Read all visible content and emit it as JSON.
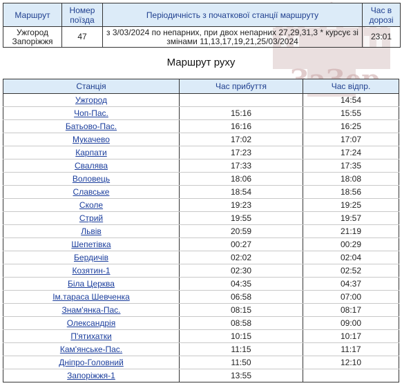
{
  "info": {
    "headers": {
      "route": "Маршрут",
      "train_no": "Номер поїзда",
      "periodicity": "Періодичність з початкової станції маршруту",
      "travel_time": "Час в дорозі"
    },
    "row": {
      "route_from": "Ужгород",
      "route_to": "Запоріжжя",
      "train_no": "47",
      "periodicity": "з 3/03/2024 по непарних, при двох непарних 27,29,31,3 * курсує зі змінами 11,13,17,19,21,25/03/2024",
      "travel_time": "23:01"
    }
  },
  "route_title": "Маршрут руху",
  "watermark_text": "ЗаЗер",
  "stations_table": {
    "headers": {
      "station": "Станція",
      "arrival": "Час прибуття",
      "departure": "Час відпр."
    },
    "rows": [
      {
        "station": "Ужгород",
        "arrival": "",
        "departure": "14:54"
      },
      {
        "station": "Чоп-Пас.",
        "arrival": "15:16",
        "departure": "15:55"
      },
      {
        "station": "Батьово-Пас.",
        "arrival": "16:16",
        "departure": "16:25"
      },
      {
        "station": "Мукачево",
        "arrival": "17:02",
        "departure": "17:07"
      },
      {
        "station": "Карпати",
        "arrival": "17:23",
        "departure": "17:24"
      },
      {
        "station": "Свалява",
        "arrival": "17:33",
        "departure": "17:35"
      },
      {
        "station": "Воловець",
        "arrival": "18:06",
        "departure": "18:08"
      },
      {
        "station": "Славське",
        "arrival": "18:54",
        "departure": "18:56"
      },
      {
        "station": "Сколе",
        "arrival": "19:23",
        "departure": "19:25"
      },
      {
        "station": "Стрий",
        "arrival": "19:55",
        "departure": "19:57"
      },
      {
        "station": "Львів",
        "arrival": "20:59",
        "departure": "21:19"
      },
      {
        "station": "Шепетівка",
        "arrival": "00:27",
        "departure": "00:29"
      },
      {
        "station": "Бердичів",
        "arrival": "02:02",
        "departure": "02:04"
      },
      {
        "station": "Козятин-1",
        "arrival": "02:30",
        "departure": "02:52"
      },
      {
        "station": "Біла Церква",
        "arrival": "04:35",
        "departure": "04:37"
      },
      {
        "station": "Ім.тараса Шевченка",
        "arrival": "06:58",
        "departure": "07:00"
      },
      {
        "station": "Знам'янка-Пас.",
        "arrival": "08:15",
        "departure": "08:17"
      },
      {
        "station": "Олександрія",
        "arrival": "08:58",
        "departure": "09:00"
      },
      {
        "station": "П'ятихатки",
        "arrival": "10:15",
        "departure": "10:17"
      },
      {
        "station": "Кам'янське-Пас.",
        "arrival": "11:15",
        "departure": "11:17"
      },
      {
        "station": "Дніпро-Головний",
        "arrival": "11:50",
        "departure": "12:10"
      },
      {
        "station": "Запоріжжя-1",
        "arrival": "13:55",
        "departure": ""
      }
    ]
  }
}
